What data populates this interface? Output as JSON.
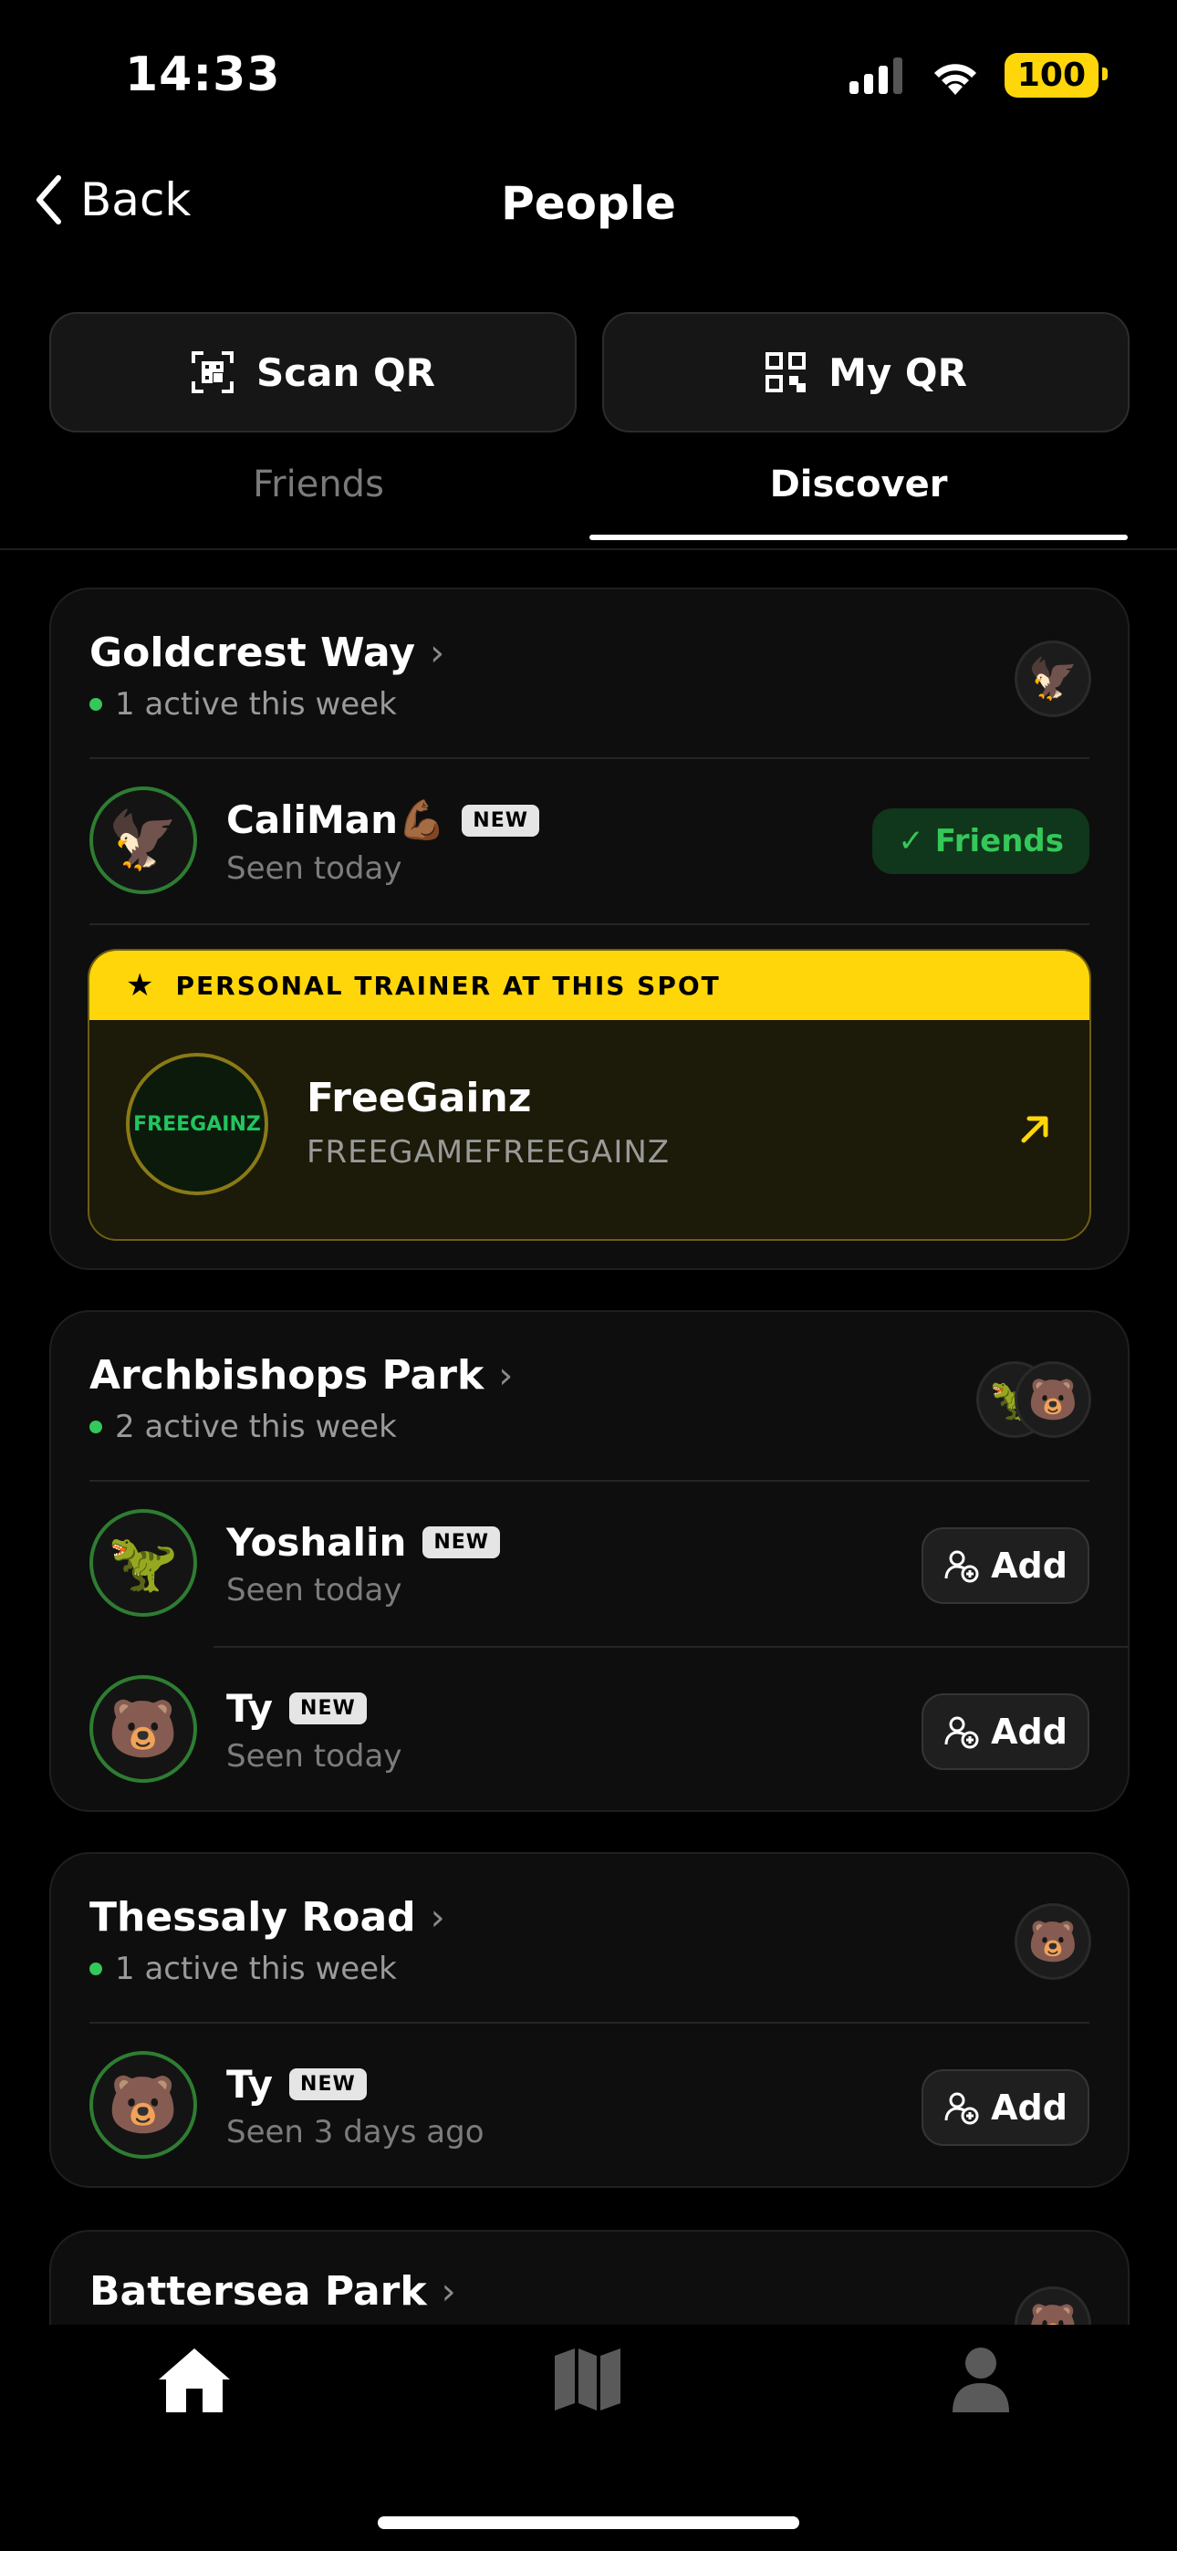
{
  "status_bar": {
    "time": "14:33",
    "battery": "100"
  },
  "nav": {
    "back_label": "Back",
    "title": "People"
  },
  "qr": {
    "scan_label": "Scan QR",
    "my_label": "My QR"
  },
  "tabs": [
    {
      "label": "Friends"
    },
    {
      "label": "Discover"
    }
  ],
  "active_tab": "Discover",
  "spots": [
    {
      "name": "Goldcrest Way",
      "active": "1 active this week",
      "avatars": [
        "🦅"
      ],
      "users": [
        {
          "name": "CaliMan💪🏾",
          "badge": "NEW",
          "seen": "Seen today",
          "avatar": "🦅",
          "action": "Friends"
        }
      ],
      "trainer": {
        "header": "PERSONAL TRAINER AT THIS SPOT",
        "name": "FreeGainz",
        "handle": "FREEGAMEFREEGAINZ",
        "logo_text": "FREEGAINZ"
      }
    },
    {
      "name": "Archbishops Park",
      "active": "2 active this week",
      "avatars": [
        "🦖",
        "🐻"
      ],
      "users": [
        {
          "name": "Yoshalin",
          "badge": "NEW",
          "seen": "Seen today",
          "avatar": "🦖",
          "action": "Add"
        },
        {
          "name": "Ty",
          "badge": "NEW",
          "seen": "Seen today",
          "avatar": "🐻",
          "action": "Add"
        }
      ]
    },
    {
      "name": "Thessaly Road",
      "active": "1 active this week",
      "avatars": [
        "🐻"
      ],
      "users": [
        {
          "name": "Ty",
          "badge": "NEW",
          "seen": "Seen 3 days ago",
          "avatar": "🐻",
          "action": "Add"
        }
      ]
    },
    {
      "name": "Battersea Park",
      "avatars": [
        "🐻"
      ]
    }
  ],
  "bottom_nav": [
    {
      "icon": "home-icon"
    },
    {
      "icon": "map-icon"
    },
    {
      "icon": "profile-icon"
    }
  ],
  "colors": {
    "accent_yellow": "#FFD60A",
    "active_green": "#34C759"
  }
}
